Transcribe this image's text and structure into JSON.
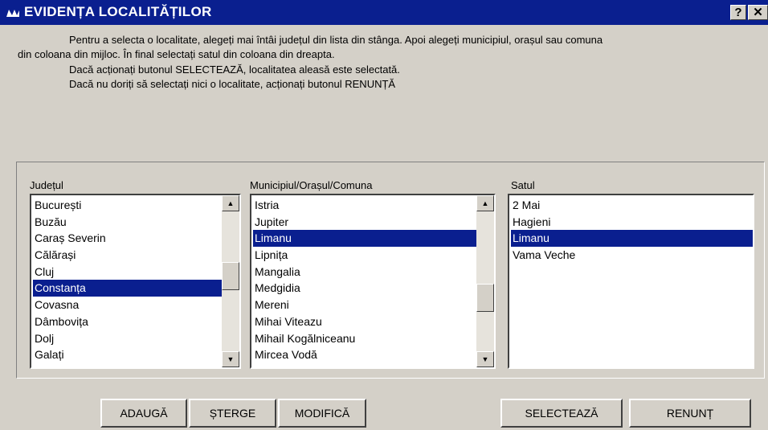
{
  "window": {
    "title": "EVIDENȚA LOCALITĂȚILOR",
    "help_label": "?",
    "close_label": "✕"
  },
  "instructions": {
    "line1": "Pentru a selecta o localitate, alegeți mai întâi județul din lista din stânga. Apoi alegeți municipiul, orașul sau comuna",
    "line2": "din coloana din mijloc. În final selectați satul din coloana din dreapta.",
    "line3": "Dacă acționați butonul SELECTEAZĂ, localitatea aleasă este selectată.",
    "line4": "Dacă nu doriți să selectați nici o localitate, acționați butonul RENUNȚĂ"
  },
  "columns": {
    "judet": {
      "label": "Județul",
      "items": [
        "București",
        "Buzău",
        "Caraș Severin",
        "Călărași",
        "Cluj",
        "Constanța",
        "Covasna",
        "Dâmbovița",
        "Dolj",
        "Galați"
      ],
      "selected_index": 5,
      "scroll_fraction": 0.45
    },
    "municipiu": {
      "label": "Municipiul/Orașul/Comuna",
      "items": [
        "Istria",
        "Jupiter",
        "Limanu",
        "Lipnița",
        "Mangalia",
        "Medgidia",
        "Mereni",
        "Mihai Viteazu",
        "Mihail Kogălniceanu",
        "Mircea Vodă"
      ],
      "selected_index": 2,
      "scroll_fraction": 0.65
    },
    "sat": {
      "label": "Satul",
      "items": [
        "2 Mai",
        "Hagieni",
        "Limanu",
        "Vama Veche"
      ],
      "selected_index": 2
    }
  },
  "buttons": {
    "adauga": "ADAUGĂ",
    "sterge": "ȘTERGE",
    "modifica": "MODIFICĂ",
    "selecteaza": "SELECTEAZĂ",
    "renunt": "RENUNȚ"
  },
  "colors": {
    "selection": "#0a1f8f",
    "face": "#d4d0c8"
  }
}
